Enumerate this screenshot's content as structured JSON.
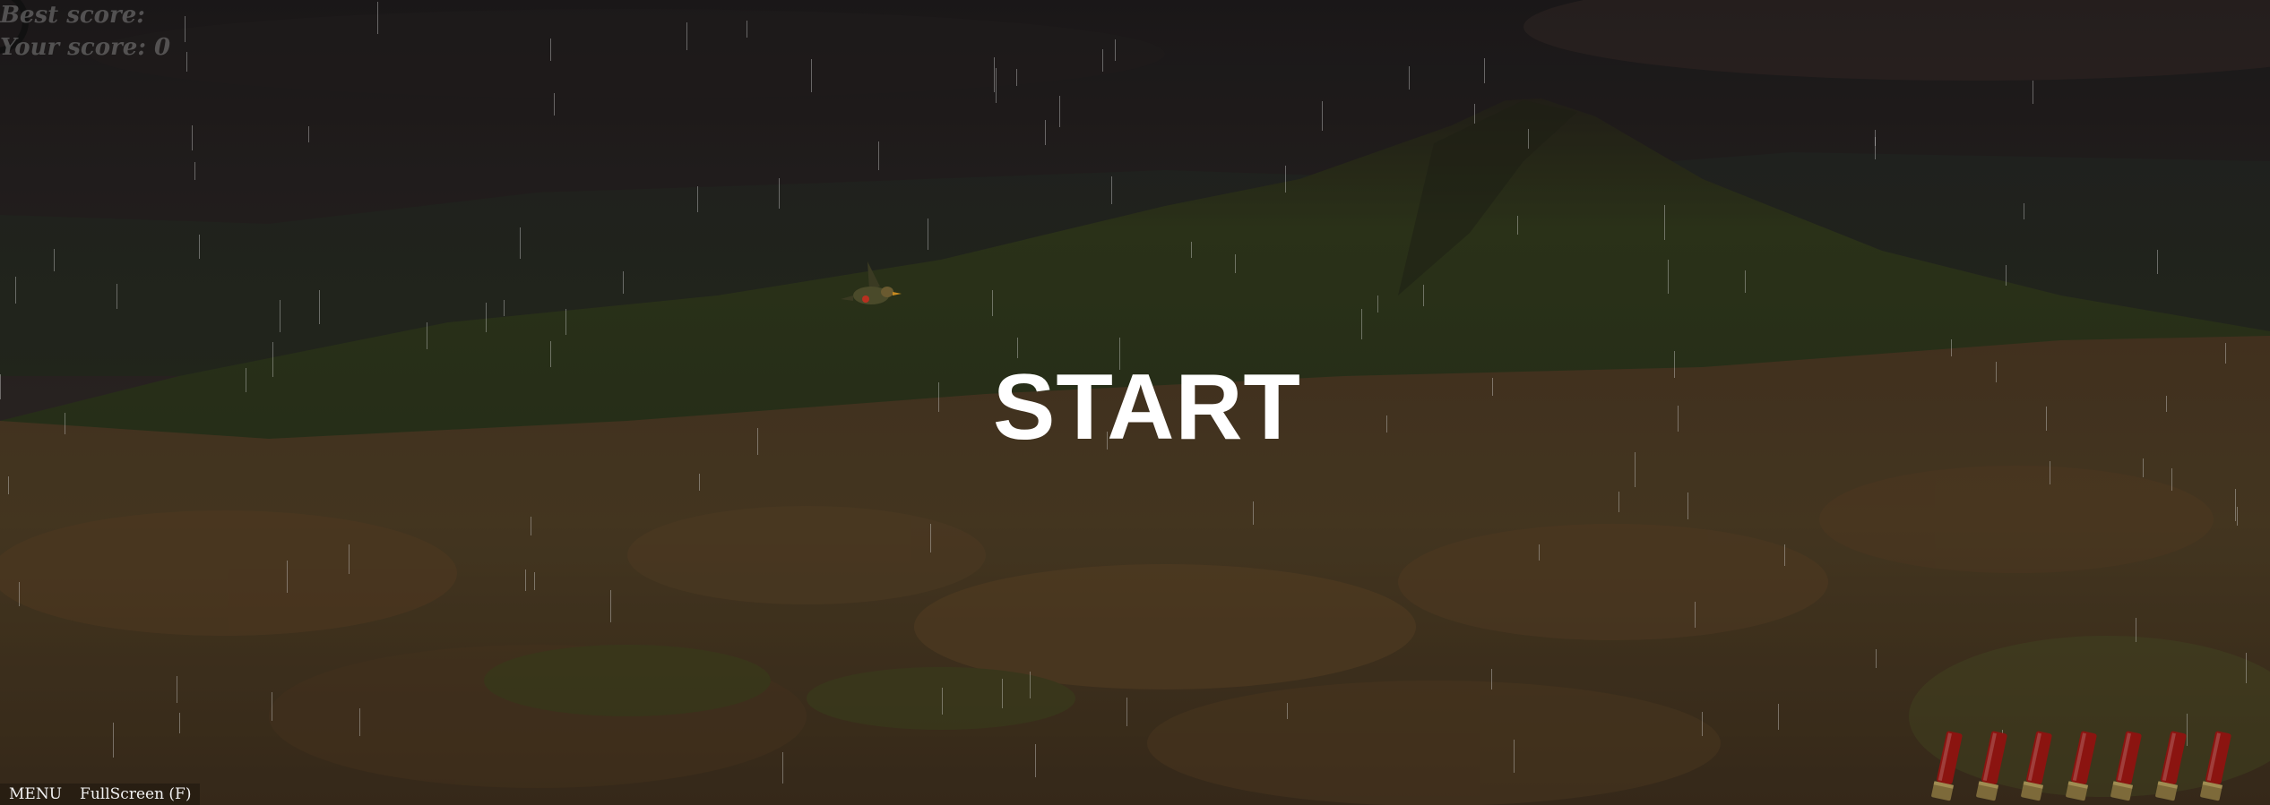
{
  "hud": {
    "best_score_label": "Best score:",
    "your_score_label": "Your score: 0"
  },
  "start_label": "START",
  "footer": {
    "menu_label": "MENU",
    "fullscreen_label": "FullScreen (F)"
  },
  "ammo": {
    "shells_remaining": 7,
    "shell_color": "#8b1410"
  },
  "sprites": {
    "bird_icon": "duck-icon",
    "spinner_icon": "loading-spinner-icon",
    "shell_icon": "shotgun-shell-icon"
  }
}
